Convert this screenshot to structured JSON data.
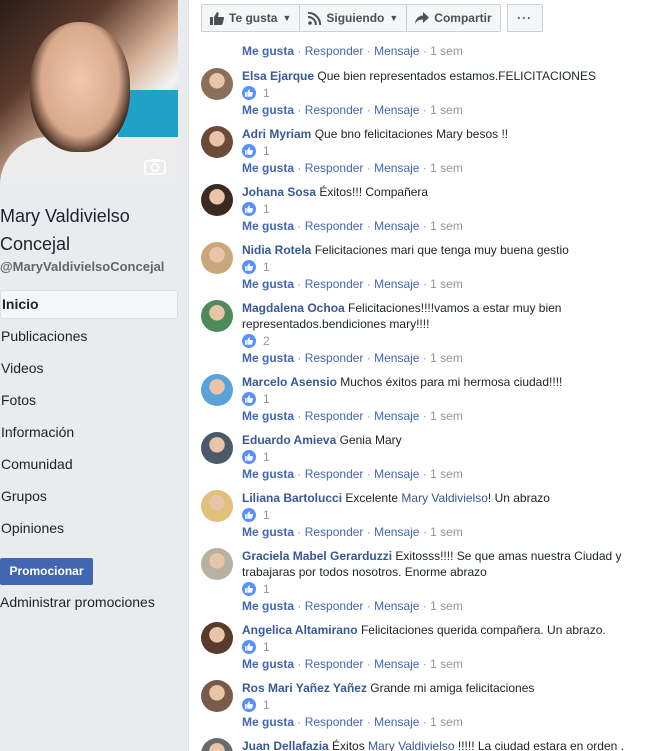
{
  "profile": {
    "name_line1": "Mary Valdivielso",
    "name_line2": "Concejal",
    "handle": "@MaryValdivielsoConcejal"
  },
  "nav": [
    "Inicio",
    "Publicaciones",
    "Videos",
    "Fotos",
    "Información",
    "Comunidad",
    "Grupos",
    "Opiniones"
  ],
  "promote_button": "Promocionar",
  "manage_promotions": "Administrar promociones",
  "actions": {
    "like": "Te gusta",
    "following": "Siguiendo",
    "share": "Compartir",
    "more": "···"
  },
  "meta": {
    "like": "Me gusta",
    "reply": "Responder",
    "message": "Mensaje",
    "sep": "·"
  },
  "top_meta_time": "1 sem",
  "comments": [
    {
      "author": "Elsa Ejarque",
      "text": "Que bien representados estamos.FELICITACIONES",
      "reactions": "1",
      "time": "1 sem",
      "avatar_color": "#8a6f5a"
    },
    {
      "author": "Adri Myriam",
      "text": "Que bno felicitaciones Mary besos !!",
      "reactions": "1",
      "time": "1 sem",
      "avatar_color": "#6b4a3a"
    },
    {
      "author": "Johana Sosa",
      "text": "Éxitos!!! Compañera",
      "reactions": "1",
      "time": "1 sem",
      "avatar_color": "#3a2a22"
    },
    {
      "author": "Nidia Rotela",
      "text": "Felicitaciones mari que tenga muy buena gestio",
      "reactions": "1",
      "time": "1 sem",
      "avatar_color": "#c9a77a"
    },
    {
      "author": "Magdalena Ochoa",
      "text": "Felicitaciones!!!!vamos a estar muy bien representados.bendiciones mary!!!!",
      "reactions": "2",
      "time": "1 sem",
      "avatar_color": "#4f8a5a"
    },
    {
      "author": "Marcelo Asensio",
      "text": "Muchos éxitos para mi hermosa ciudad!!!!",
      "reactions": "1",
      "time": "1 sem",
      "avatar_color": "#5aa3d9"
    },
    {
      "author": "Eduardo Amieva",
      "text": "Genia Mary",
      "reactions": "1",
      "time": "1 sem",
      "avatar_color": "#4a5a6a"
    },
    {
      "author": "Liliana Bartolucci",
      "text_before": "Excelente ",
      "mention": "Mary Valdivielso",
      "text_after": "! Un abrazo",
      "reactions": "1",
      "time": "1 sem",
      "avatar_color": "#e0c07a"
    },
    {
      "author": "Graciela Mabel Gerarduzzi",
      "text": "Exitosss!!!! Se que amas nuestra Ciudad y trabajaras por todos nosotros. Enorme abrazo",
      "reactions": "1",
      "time": "1 sem",
      "avatar_color": "#b8b0a0"
    },
    {
      "author": "Angelica Altamirano",
      "text": "Felicitaciones querida compañera. Un abrazo.",
      "reactions": "1",
      "time": "1 sem",
      "avatar_color": "#5a3a2a"
    },
    {
      "author": "Ros Mari Yañez Yañez",
      "text": "Grande mi amiga felicitaciones",
      "reactions": "1",
      "time": "1 sem",
      "avatar_color": "#7a5a4a"
    },
    {
      "author": "Juan Dellafazia",
      "text_before": "Éxitos ",
      "mention": "Mary Valdivielso",
      "text_after": " !!!!! La ciudad estara en orden .",
      "avatar_color": "#6a6a6a"
    }
  ],
  "colors": {
    "accent": "#4267b2",
    "link": "#385898",
    "like_blue": "#5890ff"
  }
}
